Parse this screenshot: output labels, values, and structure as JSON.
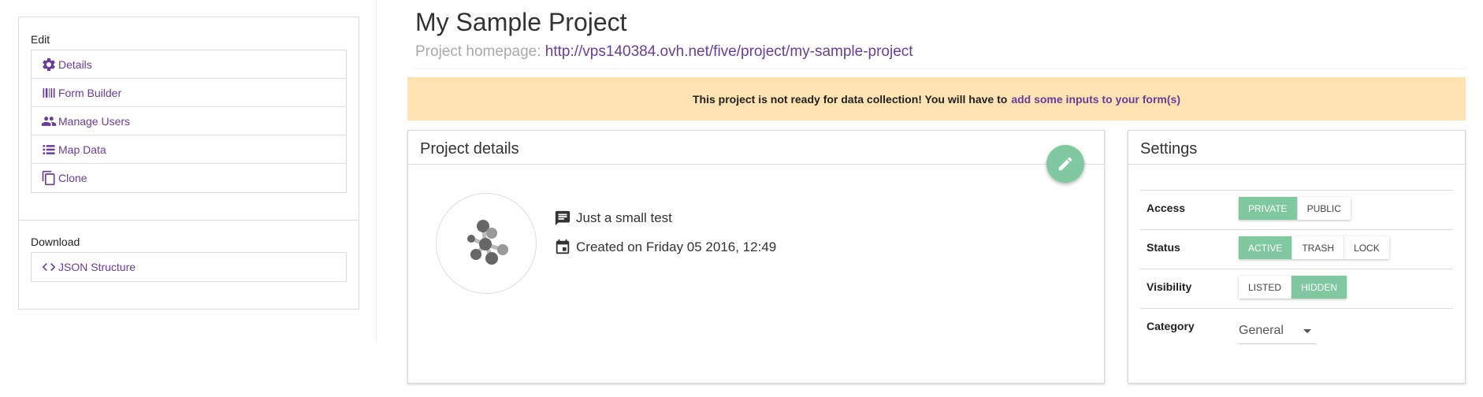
{
  "sidebar": {
    "edit_label": "Edit",
    "edit_items": [
      {
        "label": "Details",
        "icon": "gear-icon"
      },
      {
        "label": "Form Builder",
        "icon": "form-builder-icon"
      },
      {
        "label": "Manage Users",
        "icon": "users-icon"
      },
      {
        "label": "Map Data",
        "icon": "list-icon"
      },
      {
        "label": "Clone",
        "icon": "copy-icon"
      }
    ],
    "download_label": "Download",
    "download_items": [
      {
        "label": "JSON Structure",
        "icon": "code-icon"
      }
    ]
  },
  "header": {
    "title": "My Sample Project",
    "homepage_label": "Project homepage:",
    "homepage_url": "http://vps140384.ovh.net/five/project/my-sample-project"
  },
  "warning": {
    "text": "This project is not ready for data collection! You will have to",
    "link": "add some inputs to your form(s)"
  },
  "project_details": {
    "title": "Project details",
    "description": "Just a small test",
    "created": "Created on Friday 05 2016, 12:49"
  },
  "settings": {
    "title": "Settings",
    "access": {
      "label": "Access",
      "options": [
        "PRIVATE",
        "PUBLIC"
      ],
      "selected": "PRIVATE"
    },
    "status": {
      "label": "Status",
      "options": [
        "ACTIVE",
        "TRASH",
        "LOCK"
      ],
      "selected": "ACTIVE"
    },
    "visibility": {
      "label": "Visibility",
      "options": [
        "LISTED",
        "HIDDEN"
      ],
      "selected": "HIDDEN"
    },
    "category": {
      "label": "Category",
      "value": "General"
    }
  },
  "colors": {
    "accent": "#6a3d9a",
    "success": "#80c9a0",
    "warning_bg": "#ffe3b3"
  }
}
